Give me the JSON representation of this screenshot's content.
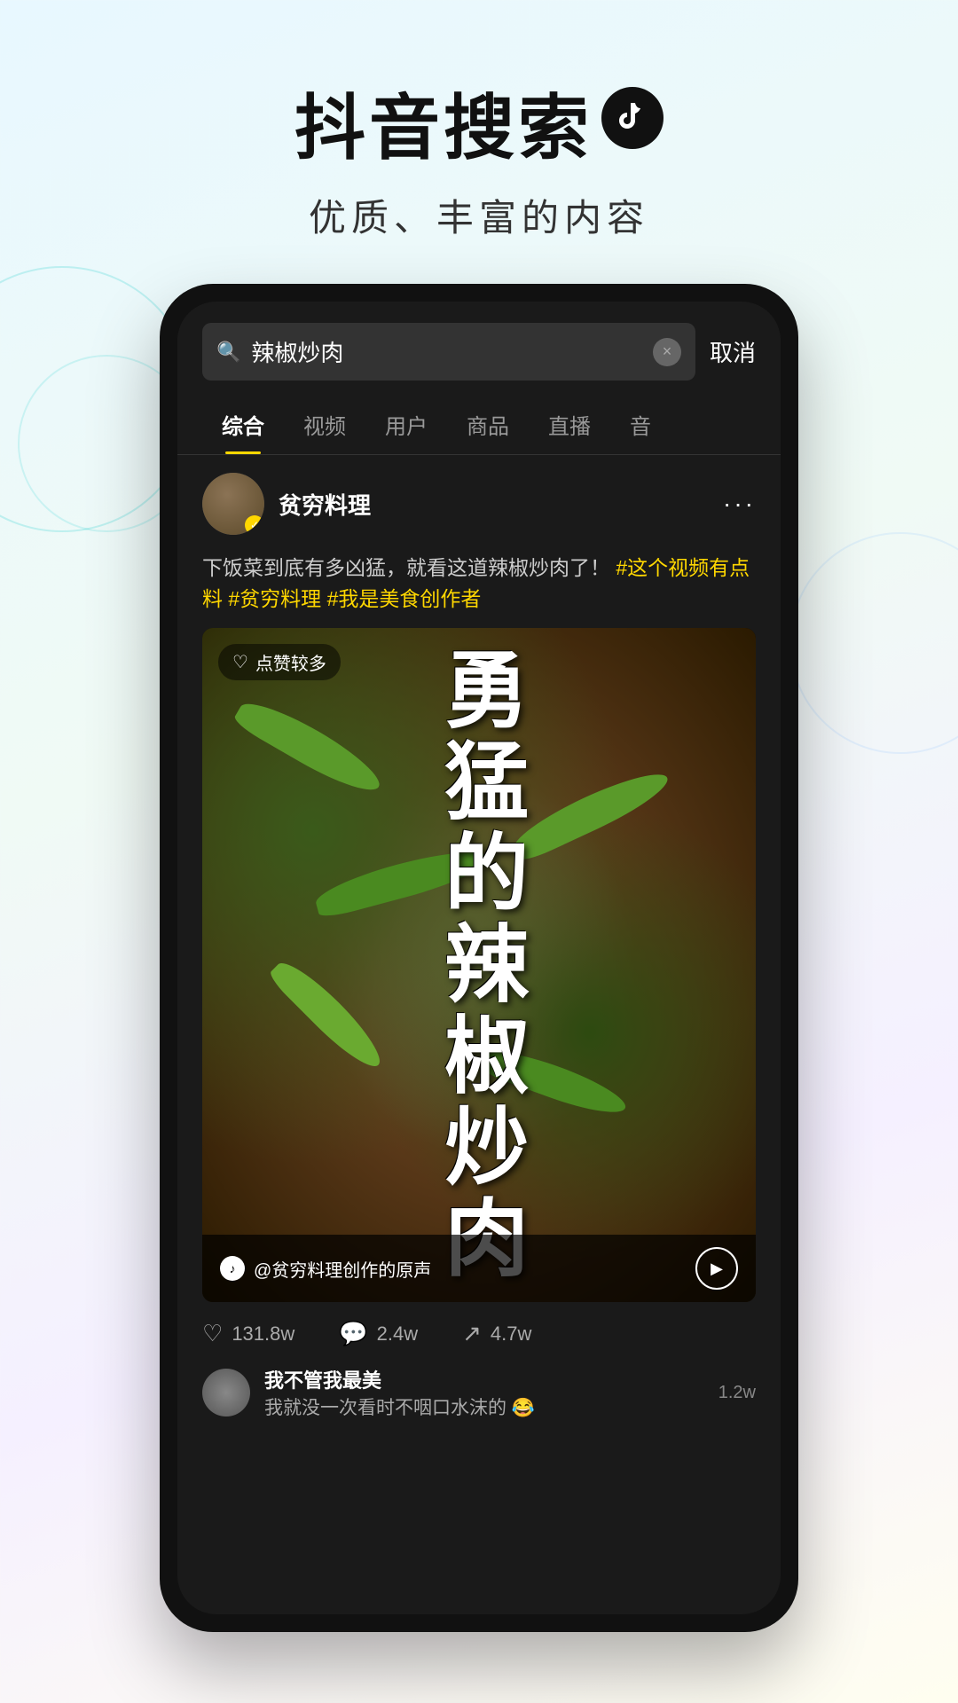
{
  "page": {
    "background": {
      "description": "light gradient background with decorative circles"
    }
  },
  "header": {
    "title": "抖音搜索",
    "subtitle": "优质、丰富的内容",
    "logo_symbol": "♪"
  },
  "phone": {
    "search_bar": {
      "query": "辣椒炒肉",
      "cancel_label": "取消",
      "clear_icon": "×",
      "search_icon": "🔍"
    },
    "tabs": [
      {
        "label": "综合",
        "active": true
      },
      {
        "label": "视频",
        "active": false
      },
      {
        "label": "用户",
        "active": false
      },
      {
        "label": "商品",
        "active": false
      },
      {
        "label": "直播",
        "active": false
      },
      {
        "label": "音",
        "active": false
      }
    ],
    "post": {
      "username": "贫穷料理",
      "verified": true,
      "body_text": "下饭菜到底有多凶猛，就看这道辣椒炒肉了！",
      "hashtags": [
        "#这个视频有点料",
        "#贫穷料理",
        "#我是美食创作者"
      ],
      "like_badge": "点赞较多",
      "video_overlay_text": "勇猛的辣椒炒肉",
      "audio_text": "@贫穷料理创作的原声",
      "stats": {
        "likes": "131.8w",
        "comments": "2.4w",
        "shares": "4.7w"
      },
      "comment_preview": {
        "user": "我不管我最美",
        "text": "我就没一次看时不咽口水沫的 😂",
        "likes": "1.2w"
      }
    }
  }
}
